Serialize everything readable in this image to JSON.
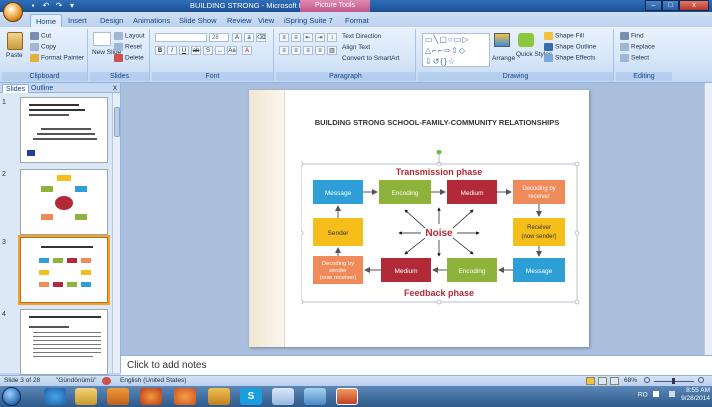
{
  "window": {
    "title": "BUILDING STRONG - Microsoft PowerPoint",
    "context_tab_title": "Picture Tools",
    "min_label": "–",
    "max_label": "□",
    "close_label": "x"
  },
  "tabs": [
    "Home",
    "Insert",
    "Design",
    "Animations",
    "Slide Show",
    "Review",
    "View",
    "iSpring Suite 7",
    "Format"
  ],
  "ribbon": {
    "clipboard": {
      "label": "Clipboard",
      "paste": "Paste",
      "cut": "Cut",
      "copy": "Copy",
      "format_painter": "Format Painter"
    },
    "slides": {
      "label": "Slides",
      "new_slide": "New Slide",
      "layout": "Layout",
      "reset": "Reset",
      "delete": "Delete"
    },
    "font": {
      "label": "Font",
      "size": "28"
    },
    "paragraph": {
      "label": "Paragraph",
      "text_direction": "Text Direction",
      "align_text": "Align Text",
      "smartart": "Convert to SmartArt"
    },
    "drawing": {
      "label": "Drawing",
      "arrange": "Arrange",
      "quick_styles": "Quick Styles",
      "shape_fill": "Shape Fill",
      "shape_outline": "Shape Outline",
      "shape_effects": "Shape Effects"
    },
    "editing": {
      "label": "Editing",
      "find": "Find",
      "replace": "Replace",
      "select": "Select"
    }
  },
  "left_pane": {
    "tab_slides": "Slides",
    "tab_outline": "Outline",
    "close_label": "x",
    "slide_numbers": [
      "1",
      "2",
      "3",
      "4"
    ]
  },
  "slide": {
    "title": "BUILDING STRONG SCHOOL-FAMILY-COMMUNITY RELATIONSHIPS",
    "diagram": {
      "top_label": "Transmission phase",
      "bottom_label": "Feedback phase",
      "center_label": "Noise",
      "boxes": {
        "message_top": "Message",
        "encoding_top": "Encoding",
        "medium_top": "Medium",
        "decoding_top": [
          "Decoding by",
          "receiver"
        ],
        "sender": "Sender",
        "receiver": [
          "Receiver",
          "(now sender)"
        ],
        "decoding_bottom": [
          "Decoding by",
          "sender",
          "(now receiver)"
        ],
        "medium_bottom": "Medium",
        "encoding_bottom": "Encoding",
        "message_bottom": "Message"
      }
    }
  },
  "notes_placeholder": "Click to add notes",
  "status": {
    "slide_info": "Slide 3 of 28",
    "theme": "\"Gündönümü\"",
    "language": "English (United States)",
    "zoom": "68%"
  },
  "tray": {
    "lang": "RO",
    "time": "8:55 AM",
    "date": "9/28/2014"
  },
  "colors": {
    "blue": "#2e9fd6",
    "green": "#8db33a",
    "red": "#b22a38",
    "orange": "#f08a5a",
    "yellow": "#f5be1a",
    "heading_red": "#b22a38"
  }
}
